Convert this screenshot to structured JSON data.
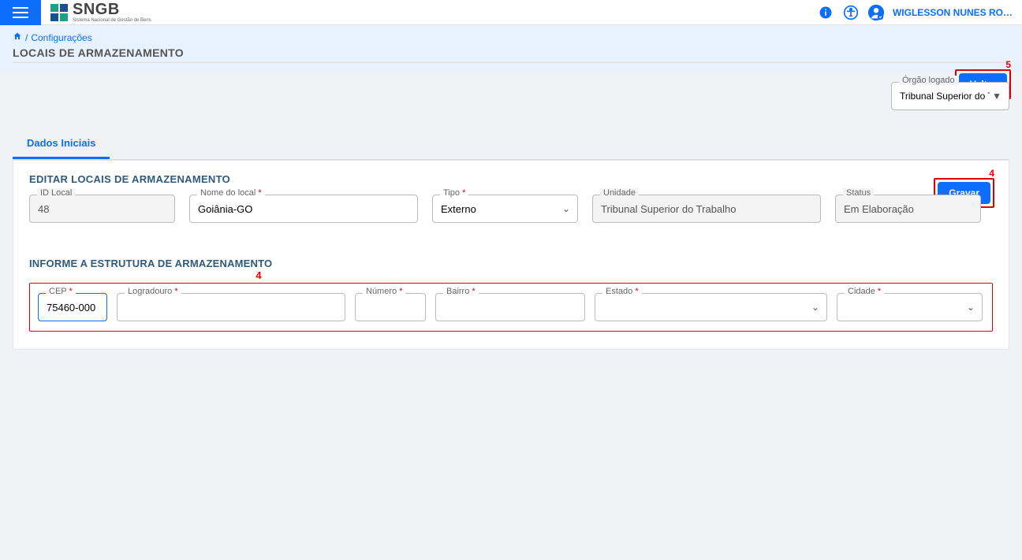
{
  "header": {
    "app_name": "SNGB",
    "app_subtitle": "Sistema Nacional de Gestão de Bens",
    "user_name": "WIGLESSON NUNES RO…"
  },
  "breadcrumb": {
    "home_label": "🏠",
    "current": "Configurações"
  },
  "page": {
    "title": "LOCAIS DE ARMAZENAMENTO",
    "back_button": "Voltar"
  },
  "orgao": {
    "label": "Órgão logado",
    "value": "Tribunal Superior do Tra…"
  },
  "tabs": {
    "dados_iniciais": "Dados Iniciais"
  },
  "form": {
    "section1_title": "EDITAR LOCAIS DE ARMAZENAMENTO",
    "save_button": "Gravar",
    "fields": {
      "id_local": {
        "label": "ID Local",
        "value": "48"
      },
      "nome_local": {
        "label": "Nome do local",
        "value": "Goiânia-GO"
      },
      "tipo": {
        "label": "Tipo",
        "value": "Externo"
      },
      "unidade": {
        "label": "Unidade",
        "value": "Tribunal Superior do Trabalho"
      },
      "status": {
        "label": "Status",
        "value": "Em Elaboração"
      }
    },
    "section2_title": "INFORME A ESTRUTURA DE ARMAZENAMENTO",
    "struct": {
      "cep": {
        "label": "CEP",
        "value": "75460-000"
      },
      "logradouro": {
        "label": "Logradouro",
        "value": ""
      },
      "numero": {
        "label": "Número",
        "value": ""
      },
      "bairro": {
        "label": "Bairro",
        "value": ""
      },
      "estado": {
        "label": "Estado",
        "value": ""
      },
      "cidade": {
        "label": "Cidade",
        "value": ""
      }
    }
  },
  "annotations": {
    "num4": "4",
    "num5": "5"
  }
}
